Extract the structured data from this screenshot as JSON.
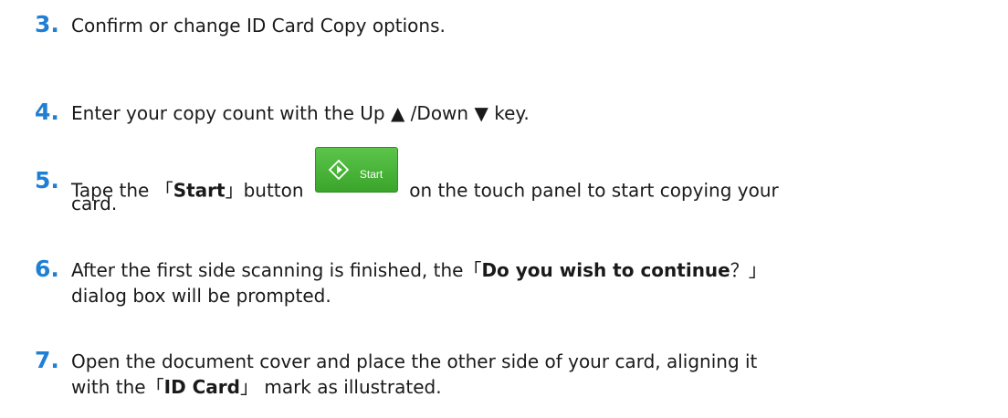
{
  "steps": [
    {
      "number": "3.",
      "text": "Confirm or change ID Card Copy options."
    },
    {
      "number": "4.",
      "text_a": "Enter your copy count with the Up ",
      "up_symbol": "▲",
      "text_b": " /Down ",
      "down_symbol": "▼",
      "text_c": " key."
    },
    {
      "number": "5.",
      "text_a": "Tape the ",
      "open_bracket": "「",
      "bold": "Start",
      "close_bracket": "」",
      "text_b": "button",
      "button_label": "Start",
      "button_icon": "start-diamond-icon",
      "text_c": "on the touch panel to start copying your",
      "text_d": "card."
    },
    {
      "number": "6.",
      "text_a": "After the first side scanning is finished, the",
      "open_bracket": "「",
      "bold": "Do you wish to continue",
      "close_bracket": "？」",
      "text_b": "dialog box will be prompted."
    },
    {
      "number": "7.",
      "text_a": "Open the document cover and place the other side of your card, aligning it",
      "text_b": "with the",
      "open_bracket": "「",
      "bold": "ID Card",
      "close_bracket": "」",
      "text_c": " mark as illustrated."
    }
  ],
  "colors": {
    "number": "#1f7fd4",
    "start_button": "#4cb53a"
  }
}
